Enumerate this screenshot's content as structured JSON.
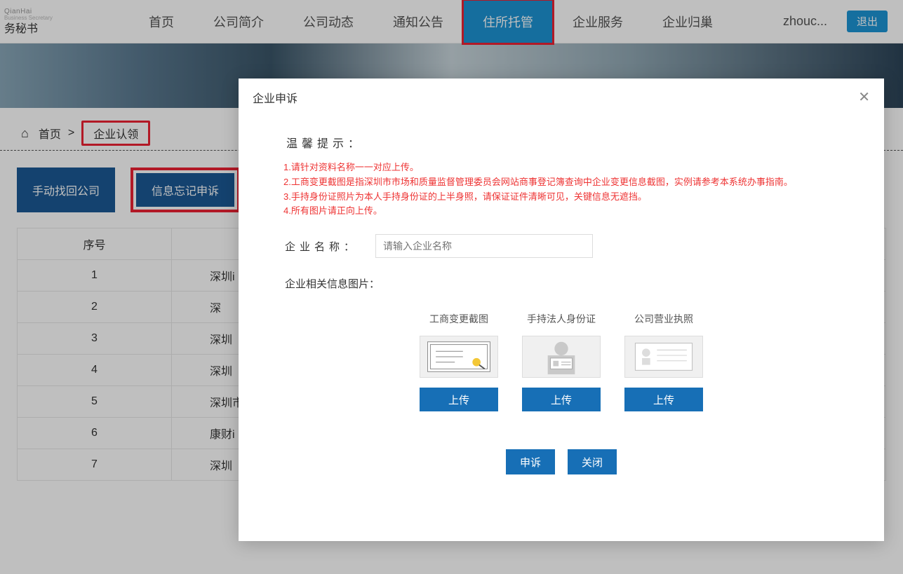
{
  "header": {
    "logo_sub1": "QianHai",
    "logo_sub2": "Business Secretary",
    "logo_main": "务秘书",
    "nav": [
      {
        "label": "首页"
      },
      {
        "label": "公司简介"
      },
      {
        "label": "公司动态"
      },
      {
        "label": "通知公告"
      },
      {
        "label": "住所托管",
        "active": true,
        "highlight": true
      },
      {
        "label": "企业服务"
      },
      {
        "label": "企业归巢"
      }
    ],
    "user": "zhouc...",
    "logout": "退出"
  },
  "breadcrumb": {
    "home": "首页",
    "sep": ">",
    "current": "企业认领"
  },
  "actions": {
    "recover": "手动找回公司",
    "appeal": "信息忘记申诉"
  },
  "table": {
    "headers": [
      "序号"
    ],
    "rows": [
      {
        "idx": "1",
        "name": "深圳i"
      },
      {
        "idx": "2",
        "name": "深"
      },
      {
        "idx": "3",
        "name": "深圳"
      },
      {
        "idx": "4",
        "name": "深圳"
      },
      {
        "idx": "5",
        "name": "深圳市"
      },
      {
        "idx": "6",
        "name": "康财i"
      },
      {
        "idx": "7",
        "name": "深圳"
      }
    ]
  },
  "modal": {
    "title": "企业申诉",
    "tip_title": "温馨提示：",
    "tips": [
      "1.请针对资料名称一一对应上传。",
      "2.工商变更截图是指深圳市市场和质量监督管理委员会网站商事登记簿查询中企业变更信息截图，实例请参考本系统办事指南。",
      "3.手持身份证照片为本人手持身份证的上半身照，请保证证件清晰可见，关键信息无遮挡。",
      "4.所有图片请正向上传。"
    ],
    "name_label": "企业名称：",
    "name_placeholder": "请输入企业名称",
    "pic_label": "企业相关信息图片：",
    "uploads": [
      {
        "caption": "工商变更截图",
        "btn": "上传"
      },
      {
        "caption": "手持法人身份证",
        "btn": "上传"
      },
      {
        "caption": "公司营业执照",
        "btn": "上传"
      }
    ],
    "submit": "申诉",
    "close_btn": "关闭"
  }
}
